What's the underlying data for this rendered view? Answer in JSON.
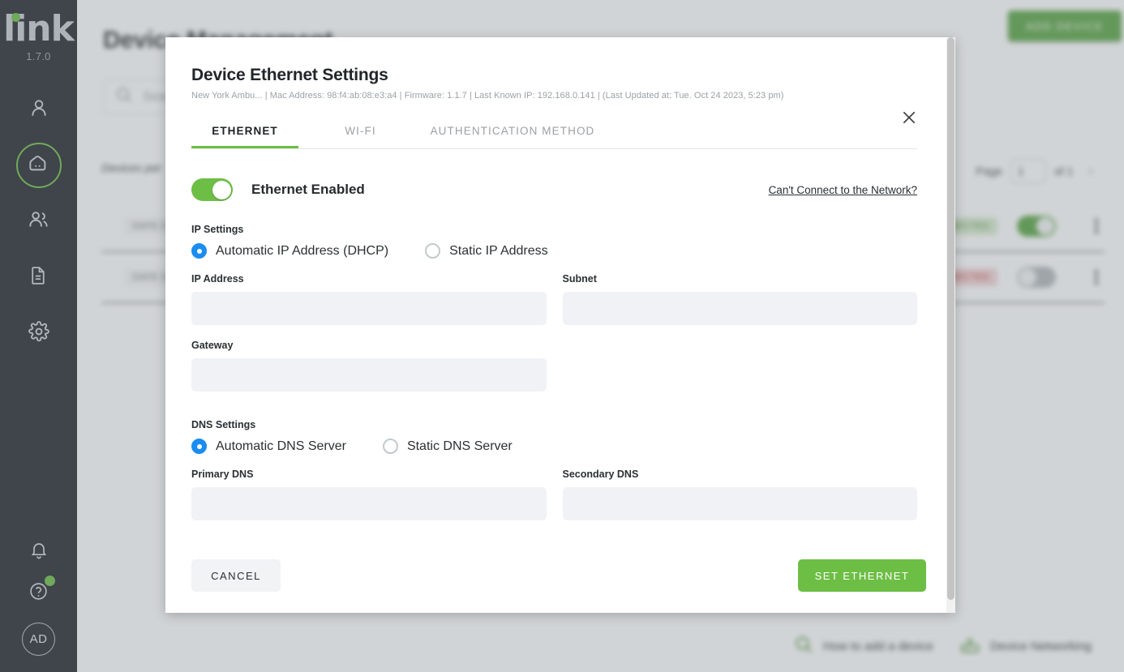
{
  "sidebar": {
    "logo_text": "link",
    "version": "1.7.0",
    "nav_items": [
      {
        "icon": "user-icon",
        "name": "sidebar-item-profile",
        "active": false
      },
      {
        "icon": "device-icon",
        "name": "sidebar-item-devices",
        "active": true
      },
      {
        "icon": "users-icon",
        "name": "sidebar-item-groups",
        "active": false
      },
      {
        "icon": "document-icon",
        "name": "sidebar-item-reports",
        "active": false
      },
      {
        "icon": "gear-icon",
        "name": "sidebar-item-settings",
        "active": false
      }
    ],
    "bottom": {
      "bell_icon": "bell-icon",
      "help_icon": "help-circle-icon",
      "avatar_initials": "AD"
    }
  },
  "page": {
    "title": "Device Management",
    "add_device_label": "ADD DEVICE",
    "search_placeholder": "Search",
    "search_icon": "search-icon",
    "devices_per_label": "Devices per",
    "pager": {
      "page_label": "Page",
      "page_value": "1",
      "of_label": "of 1",
      "next_icon": "chevron-right-icon"
    },
    "rows": [
      {
        "badge_left": "SAFE 0",
        "badge_right": "CONNECTED",
        "badge_right_state": "connected",
        "toggle": "on"
      },
      {
        "badge_left": "SAFE 0",
        "badge_right": "DISCONNECTED",
        "badge_right_state": "disconnected",
        "toggle": "off"
      }
    ],
    "bottom_links": [
      {
        "icon": "search-icon",
        "label": "How to add a device"
      },
      {
        "icon": "router-icon",
        "label": "Device Networking"
      }
    ]
  },
  "modal": {
    "title": "Device Ethernet Settings",
    "subtitle": "New York Ambu... | Mac Address: 98:f4:ab:08:e3:a4 | Firmware: 1.1.7 | Last Known IP: 192.168.0.141 | (Last Updated at: Tue. Oct 24 2023, 5:23 pm)",
    "close_icon": "close-icon",
    "tabs": [
      {
        "label": "ETHERNET",
        "active": true
      },
      {
        "label": "WI-FI",
        "active": false
      },
      {
        "label": "AUTHENTICATION METHOD",
        "active": false
      }
    ],
    "ethernet_toggle": {
      "label": "Ethernet Enabled",
      "state": "on"
    },
    "help_link": "Can't Connect to the Network?",
    "ip_settings": {
      "group_label": "IP Settings",
      "options": [
        {
          "label": "Automatic IP Address (DHCP)",
          "selected": true
        },
        {
          "label": "Static IP Address",
          "selected": false
        }
      ]
    },
    "ip_fields": {
      "ip_address_label": "IP Address",
      "ip_address_value": "",
      "subnet_label": "Subnet",
      "subnet_value": "",
      "gateway_label": "Gateway",
      "gateway_value": ""
    },
    "dns_settings": {
      "group_label": "DNS Settings",
      "options": [
        {
          "label": "Automatic DNS Server",
          "selected": true
        },
        {
          "label": "Static DNS Server",
          "selected": false
        }
      ]
    },
    "dns_fields": {
      "primary_label": "Primary DNS",
      "primary_value": "",
      "secondary_label": "Secondary DNS",
      "secondary_value": ""
    },
    "footer": {
      "cancel_label": "CANCEL",
      "submit_label": "SET ETHERNET"
    }
  },
  "colors": {
    "brand_green": "#6dbe45",
    "button_green": "#5aa544",
    "radio_blue": "#1b8df0",
    "sidebar_dark": "#22272b",
    "connected": "#4f9138",
    "disconnected": "#c0392f"
  }
}
